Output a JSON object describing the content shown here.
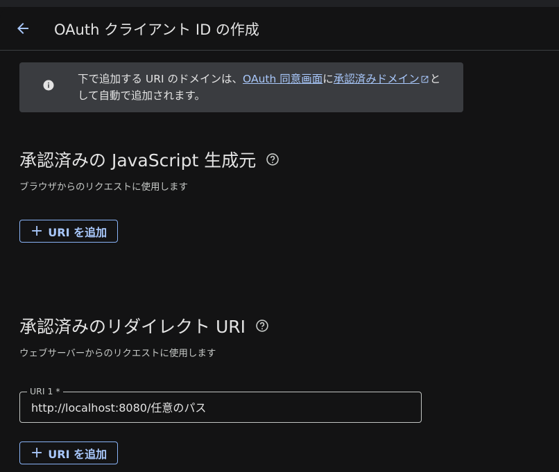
{
  "header": {
    "back_icon": "arrow-back-icon",
    "title": "OAuth クライアント ID の作成"
  },
  "notice": {
    "icon": "info-icon",
    "text_before": "下で追加する URI のドメインは、",
    "link1": "OAuth 同意画面",
    "text_mid": "に",
    "link2": "承認済みドメイン",
    "link2_icon": "open-in-new-icon",
    "text_after": "として自動で追加されます。"
  },
  "js_origins": {
    "title": "承認済みの JavaScript 生成元",
    "help_icon": "help-icon",
    "description": "ブラウザからのリクエストに使用します",
    "add_button": "URI を追加"
  },
  "redirect_uris": {
    "title": "承認済みのリダイレクト URI",
    "help_icon": "help-icon",
    "description": "ウェブサーバーからのリクエストに使用します",
    "field_label": "URI 1 *",
    "field_value": "http://localhost:8080/任意のパス",
    "add_button": "URI を追加"
  },
  "colors": {
    "background": "#131314",
    "accent": "#a8c7fa",
    "notice_bg": "#3a3c40"
  }
}
